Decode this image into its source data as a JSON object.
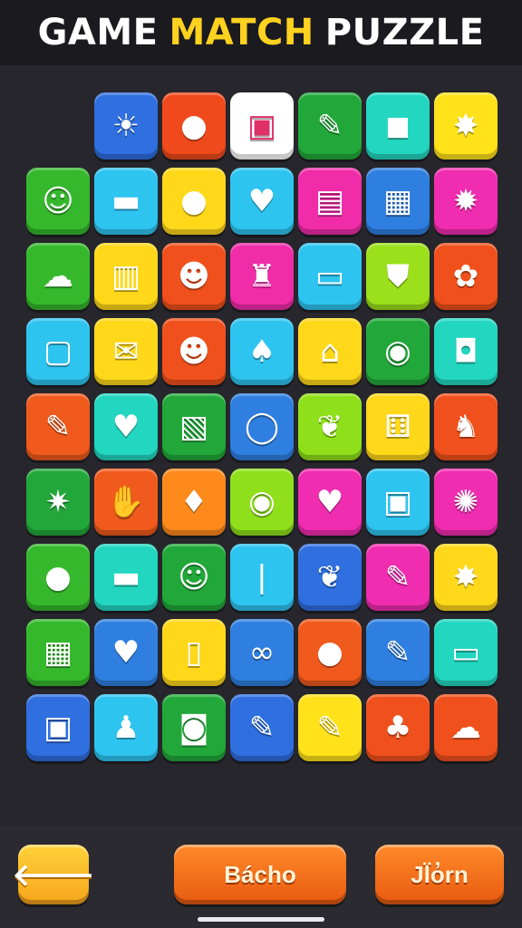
{
  "header": {
    "title_words": [
      {
        "text": "GAME",
        "color": "#ffffff"
      },
      {
        "text": "MATCH",
        "color": "#ffd21f"
      },
      {
        "text": "PUZZLE",
        "color": "#ffffff"
      }
    ]
  },
  "board": {
    "rows": [
      [
        null,
        {
          "color": "#2f6fe0",
          "icon": "sun-icon",
          "glyph": "☀"
        },
        {
          "color": "#f04a1c",
          "icon": "tomato-icon",
          "glyph": "●"
        },
        {
          "color": "#ffffff",
          "icon": "jar-icon",
          "glyph": "▣"
        },
        {
          "color": "#22a83a",
          "icon": "marker-icon",
          "glyph": "✎"
        },
        {
          "color": "#22d6c0",
          "icon": "car-icon",
          "glyph": "◼"
        },
        {
          "color": "#ffe21a",
          "icon": "badge-icon",
          "glyph": "✸"
        }
      ],
      [
        {
          "color": "#35b82c",
          "icon": "sun-face-icon",
          "glyph": "☺"
        },
        {
          "color": "#2ec4f0",
          "icon": "gift-box-icon",
          "glyph": "▬"
        },
        {
          "color": "#ffd81a",
          "icon": "apple-icon",
          "glyph": "●"
        },
        {
          "color": "#2ec4f0",
          "icon": "heart-icon",
          "glyph": "♥"
        },
        {
          "color": "#f02ca8",
          "icon": "paper-icon",
          "glyph": "▤"
        },
        {
          "color": "#2f7fe0",
          "icon": "tablet-icon",
          "glyph": "▦"
        },
        {
          "color": "#f02cb0",
          "icon": "star-sun-icon",
          "glyph": "✹"
        }
      ],
      [
        {
          "color": "#35b82c",
          "icon": "speech-bubble-icon",
          "glyph": "☁"
        },
        {
          "color": "#ffd81a",
          "icon": "book-icon",
          "glyph": "▥"
        },
        {
          "color": "#f0501c",
          "icon": "ghost-icon",
          "glyph": "☻"
        },
        {
          "color": "#f02ca8",
          "icon": "bottle-icon",
          "glyph": "♜"
        },
        {
          "color": "#2ec4f0",
          "icon": "wallet-icon",
          "glyph": "▭"
        },
        {
          "color": "#9be01a",
          "icon": "shield-icon",
          "glyph": "⛊"
        },
        {
          "color": "#f0501c",
          "icon": "flower-icon",
          "glyph": "✿"
        }
      ],
      [
        {
          "color": "#2ec4f0",
          "icon": "camera-icon",
          "glyph": "▢"
        },
        {
          "color": "#ffd81a",
          "icon": "envelope-icon",
          "glyph": "✉"
        },
        {
          "color": "#f0501c",
          "icon": "bear-icon",
          "glyph": "☻"
        },
        {
          "color": "#2ec4f0",
          "icon": "paddle-icon",
          "glyph": "♠"
        },
        {
          "color": "#ffd81a",
          "icon": "house-icon",
          "glyph": "⌂"
        },
        {
          "color": "#22a83a",
          "icon": "ball-icon",
          "glyph": "◉"
        },
        {
          "color": "#22d6c0",
          "icon": "square-button-icon",
          "glyph": "◘"
        }
      ],
      [
        {
          "color": "#f05a1c",
          "icon": "pencil-icon",
          "glyph": "✎"
        },
        {
          "color": "#22d6c0",
          "icon": "heart-icon",
          "glyph": "♥"
        },
        {
          "color": "#22a83a",
          "icon": "present-icon",
          "glyph": "▧"
        },
        {
          "color": "#2f7fe0",
          "icon": "ring-icon",
          "glyph": "◯"
        },
        {
          "color": "#8fe01a",
          "icon": "leaf-icon",
          "glyph": "❦"
        },
        {
          "color": "#ffd81a",
          "icon": "dice-icon",
          "glyph": "⚅"
        },
        {
          "color": "#f0501c",
          "icon": "cat-icon",
          "glyph": "♞"
        }
      ],
      [
        {
          "color": "#22a83a",
          "icon": "bug-icon",
          "glyph": "✷"
        },
        {
          "color": "#f05a1c",
          "icon": "hand-icon",
          "glyph": "✋"
        },
        {
          "color": "#ff8a1c",
          "icon": "drop-icon",
          "glyph": "♦"
        },
        {
          "color": "#8fe01a",
          "icon": "target-icon",
          "glyph": "◉"
        },
        {
          "color": "#f02cb0",
          "icon": "heart-icon",
          "glyph": "♥"
        },
        {
          "color": "#2ec4f0",
          "icon": "jar-icon",
          "glyph": "▣"
        },
        {
          "color": "#f02cb0",
          "icon": "candy-icon",
          "glyph": "✺"
        }
      ],
      [
        {
          "color": "#35b82c",
          "icon": "medal-icon",
          "glyph": "●"
        },
        {
          "color": "#22d6c0",
          "icon": "chest-icon",
          "glyph": "▬"
        },
        {
          "color": "#22a83a",
          "icon": "cookie-icon",
          "glyph": "☺"
        },
        {
          "color": "#2ec4f0",
          "icon": "tube-icon",
          "glyph": "❘"
        },
        {
          "color": "#2f6fe0",
          "icon": "leaf-icon",
          "glyph": "❦"
        },
        {
          "color": "#f02cb0",
          "icon": "pencil-icon",
          "glyph": "✎"
        },
        {
          "color": "#ffd81a",
          "icon": "star-icon",
          "glyph": "✸"
        }
      ],
      [
        {
          "color": "#35b82c",
          "icon": "calendar-icon",
          "glyph": "▦"
        },
        {
          "color": "#2f7fe0",
          "icon": "heart-icon",
          "glyph": "♥"
        },
        {
          "color": "#ffd81a",
          "icon": "phone-icon",
          "glyph": "▯"
        },
        {
          "color": "#2f7fe0",
          "icon": "handcuffs-icon",
          "glyph": "∞"
        },
        {
          "color": "#f05a1c",
          "icon": "egg-icon",
          "glyph": "●"
        },
        {
          "color": "#2f7fe0",
          "icon": "pencil-icon",
          "glyph": "✎"
        },
        {
          "color": "#22d6c0",
          "icon": "card-icon",
          "glyph": "▭"
        }
      ],
      [
        {
          "color": "#2f6fe0",
          "icon": "box-icon",
          "glyph": "▣"
        },
        {
          "color": "#2ec4f0",
          "icon": "bottle-icon",
          "glyph": "♟"
        },
        {
          "color": "#22a83a",
          "icon": "camera-icon",
          "glyph": "◙"
        },
        {
          "color": "#2f6fe0",
          "icon": "pencil-icon",
          "glyph": "✎"
        },
        {
          "color": "#ffe21a",
          "icon": "crayon-icon",
          "glyph": "✎"
        },
        {
          "color": "#f0501c",
          "icon": "potion-icon",
          "glyph": "♣"
        },
        {
          "color": "#f0501c",
          "icon": "cloud-icon",
          "glyph": "☁"
        }
      ]
    ]
  },
  "controls": {
    "back_glyph": "🡐",
    "mid_label": "Bácho",
    "right_label": "Jl̈o̓rn"
  }
}
